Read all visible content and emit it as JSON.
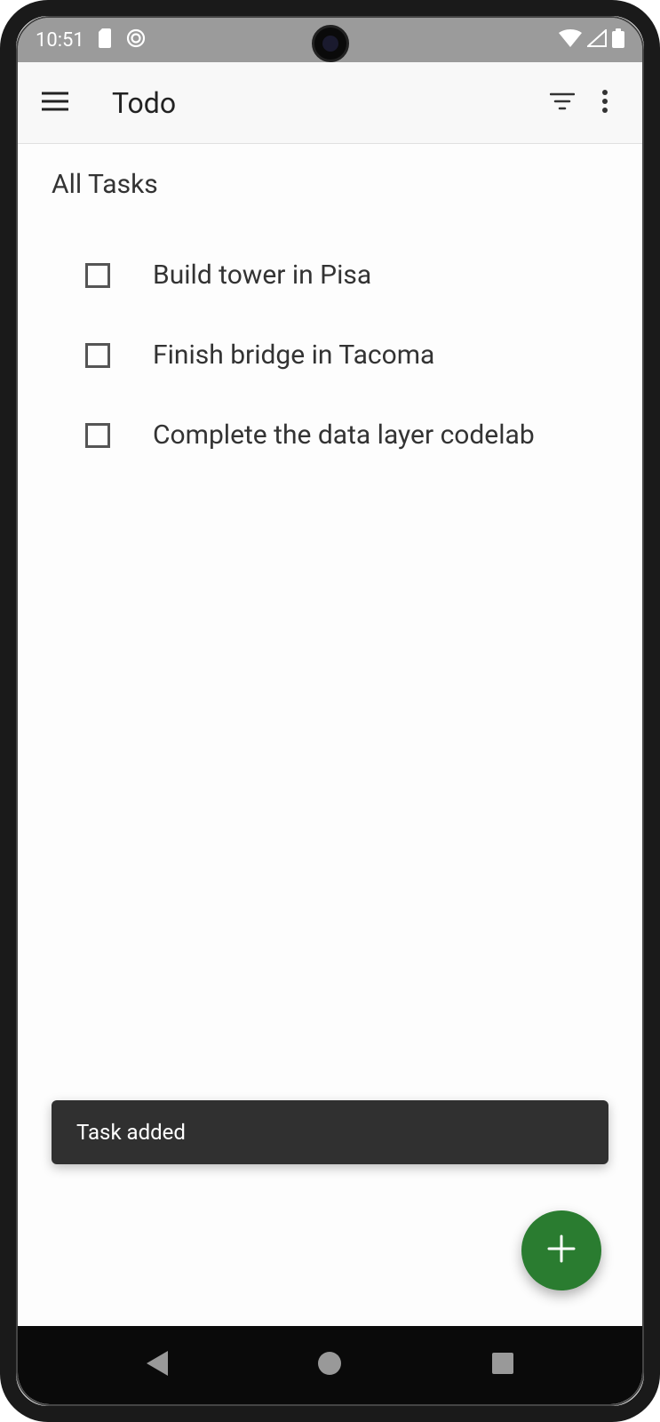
{
  "statusBar": {
    "time": "10:51"
  },
  "appBar": {
    "title": "Todo"
  },
  "content": {
    "sectionTitle": "All Tasks",
    "tasks": [
      {
        "label": "Build tower in Pisa",
        "checked": false
      },
      {
        "label": "Finish bridge in Tacoma",
        "checked": false
      },
      {
        "label": "Complete the data layer codelab",
        "checked": false
      }
    ]
  },
  "snackbar": {
    "message": "Task added"
  },
  "colors": {
    "fab": "#2a7c30",
    "snackbar": "#303030"
  }
}
